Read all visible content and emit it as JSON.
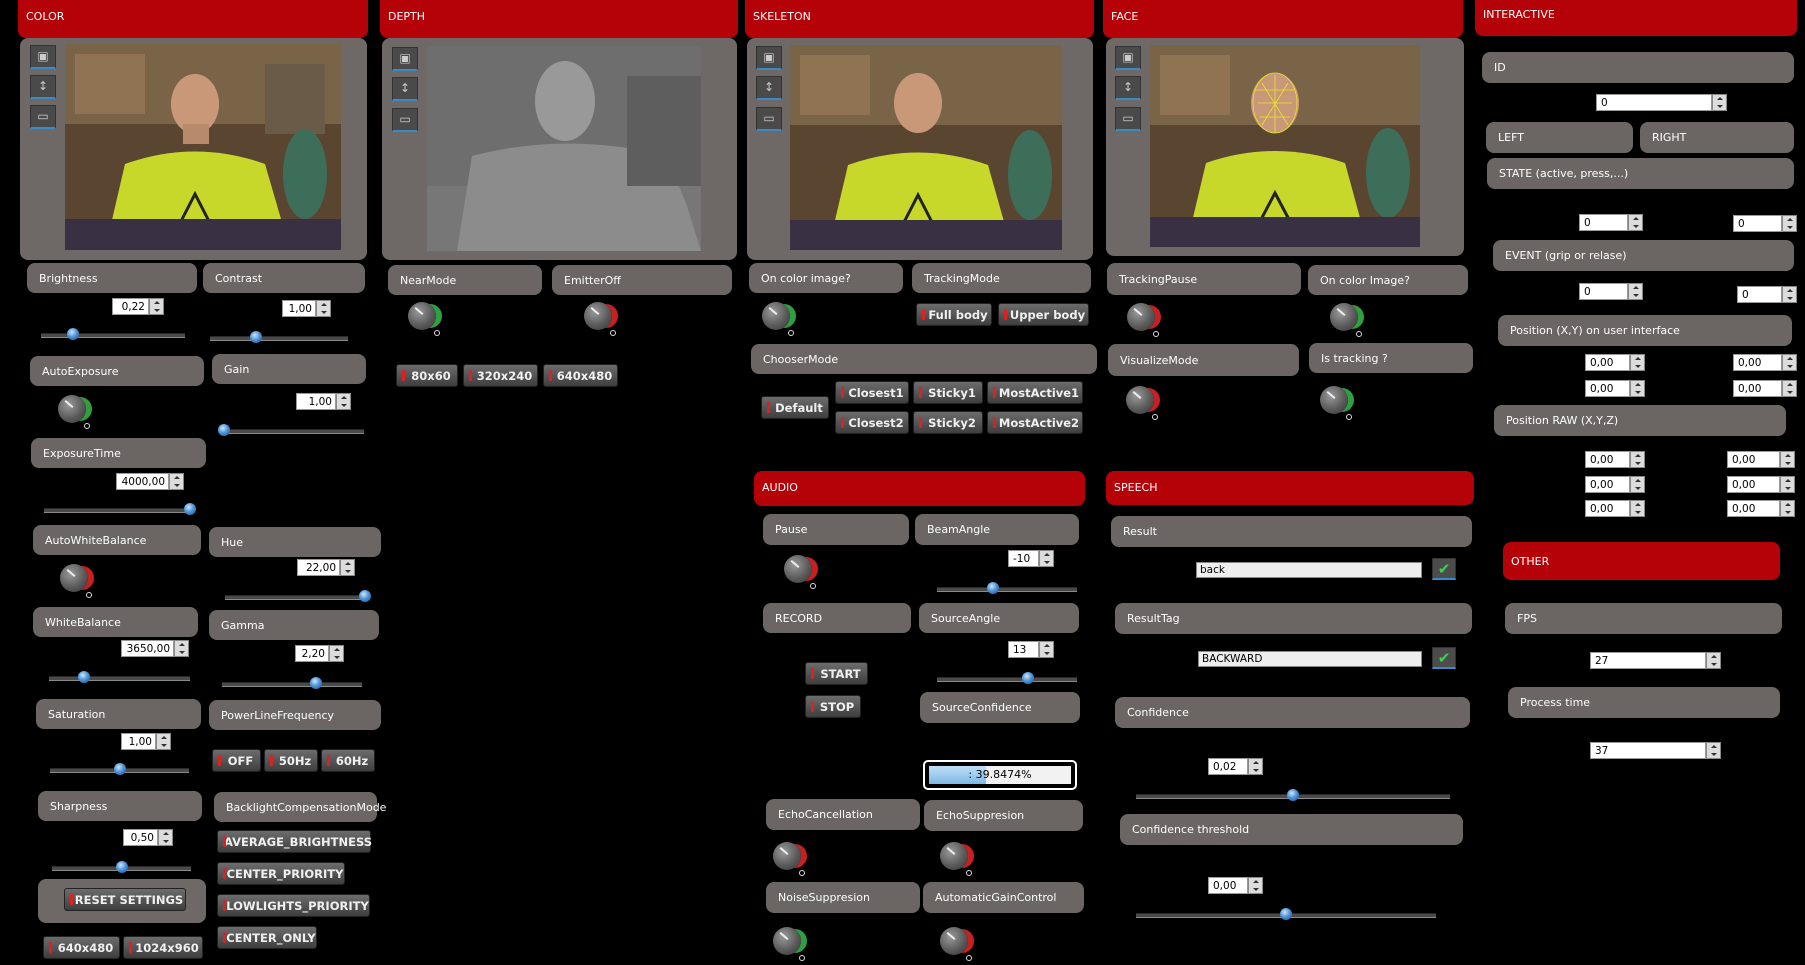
{
  "headers": {
    "color": "COLOR",
    "depth": "DEPTH",
    "skeleton": "SKELETON",
    "face": "FACE",
    "interactive": "INTERACTIVE",
    "audio": "AUDIO",
    "speech": "SPEECH",
    "other": "OTHER"
  },
  "color": {
    "brightness": {
      "label": "Brightness",
      "value": "0,22",
      "level": 0.22
    },
    "contrast": {
      "label": "Contrast",
      "value": "1,00",
      "level": 0.33
    },
    "auto_exposure": "AutoExposure",
    "gain": {
      "label": "Gain",
      "value": "1,00",
      "level": 0.0
    },
    "exposure_time": {
      "label": "ExposureTime",
      "value": "4000,00",
      "level": 1.0
    },
    "auto_white_balance": "AutoWhiteBalance",
    "hue": {
      "label": "Hue",
      "value": "22,00",
      "level": 1.0
    },
    "white_balance": {
      "label": "WhiteBalance",
      "value": "3650,00",
      "level": 0.25
    },
    "gamma": {
      "label": "Gamma",
      "value": "2,20",
      "level": 0.67
    },
    "saturation": {
      "label": "Saturation",
      "value": "1,00",
      "level": 0.5
    },
    "power_line_frequency": "PowerLineFrequency",
    "plf_buttons": [
      "OFF",
      "50Hz",
      "60Hz"
    ],
    "sharpness": {
      "label": "Sharpness",
      "value": "0,50",
      "level": 0.5
    },
    "backlight_mode": "BacklightCompensationMode",
    "backlight_buttons": [
      "AVERAGE_BRIGHTNESS",
      "CENTER_PRIORITY",
      "LOWLIGHTS_PRIORITY",
      "CENTER_ONLY"
    ],
    "reset": "RESET SETTINGS",
    "res_buttons": [
      "640x480",
      "1024x960"
    ]
  },
  "depth": {
    "near_mode": "NearMode",
    "emitter_off": "EmitterOff",
    "res_buttons": [
      "80x60",
      "320x240",
      "640x480"
    ]
  },
  "skeleton": {
    "on_color": "On color image?",
    "tracking_mode": "TrackingMode",
    "tracking_buttons": [
      "Full body",
      "Upper body"
    ],
    "chooser_mode": "ChooserMode",
    "default_btn": "Default",
    "chooser_buttons": [
      "Closest1",
      "Sticky1",
      "MostActive1",
      "Closest2",
      "Sticky2",
      "MostActive2"
    ]
  },
  "face": {
    "tracking_pause": "TrackingPause",
    "on_color": "On color Image?",
    "visualize_mode": "VisualizeMode",
    "is_tracking": "Is tracking ?"
  },
  "audio": {
    "pause": "Pause",
    "beam_angle": {
      "label": "BeamAngle",
      "value": "-10",
      "level": 0.4
    },
    "record": "RECORD",
    "source_angle": {
      "label": "SourceAngle",
      "value": "13",
      "level": 0.65
    },
    "start": "START",
    "stop": "STOP",
    "source_confidence": "SourceConfidence",
    "confidence_progress": ": 39.8474%",
    "confidence_level": 0.398,
    "echo_cancellation": "EchoCancellation",
    "echo_suppresion": "EchoSuppresion",
    "noise_suppresion": "NoiseSuppresion",
    "agc": "AutomaticGainControl"
  },
  "speech": {
    "result": "Result",
    "result_value": "back",
    "result_tag": "ResultTag",
    "result_tag_value": "BACKWARD",
    "confidence": {
      "label": "Confidence",
      "value": "0,02",
      "level": 0.5
    },
    "confidence_threshold": {
      "label": "Confidence threshold",
      "value": "0,00",
      "level": 0.5
    }
  },
  "interactive": {
    "id": "ID",
    "id_value": "0",
    "left": "LEFT",
    "right": "RIGHT",
    "state": "STATE (active, press,...)",
    "state_left": "0",
    "state_right": "0",
    "event": "EVENT (grip or relase)",
    "event_left": "0",
    "event_right": "0",
    "position_ui": "Position (X,Y) on user interface",
    "pos_ui_values": [
      "0,00",
      "0,00",
      "0,00",
      "0,00"
    ],
    "position_raw": "Position RAW (X,Y,Z)",
    "pos_raw_values": [
      "0,00",
      "0,00",
      "0,00",
      "0,00",
      "0,00",
      "0,00"
    ]
  },
  "other": {
    "fps": "FPS",
    "fps_value": "27",
    "process_time": "Process time",
    "process_time_value": "37"
  },
  "colors": {
    "header_red": "#b40208",
    "panel_gray": "#6e6866",
    "accent_blue": "#3a8ac8"
  }
}
